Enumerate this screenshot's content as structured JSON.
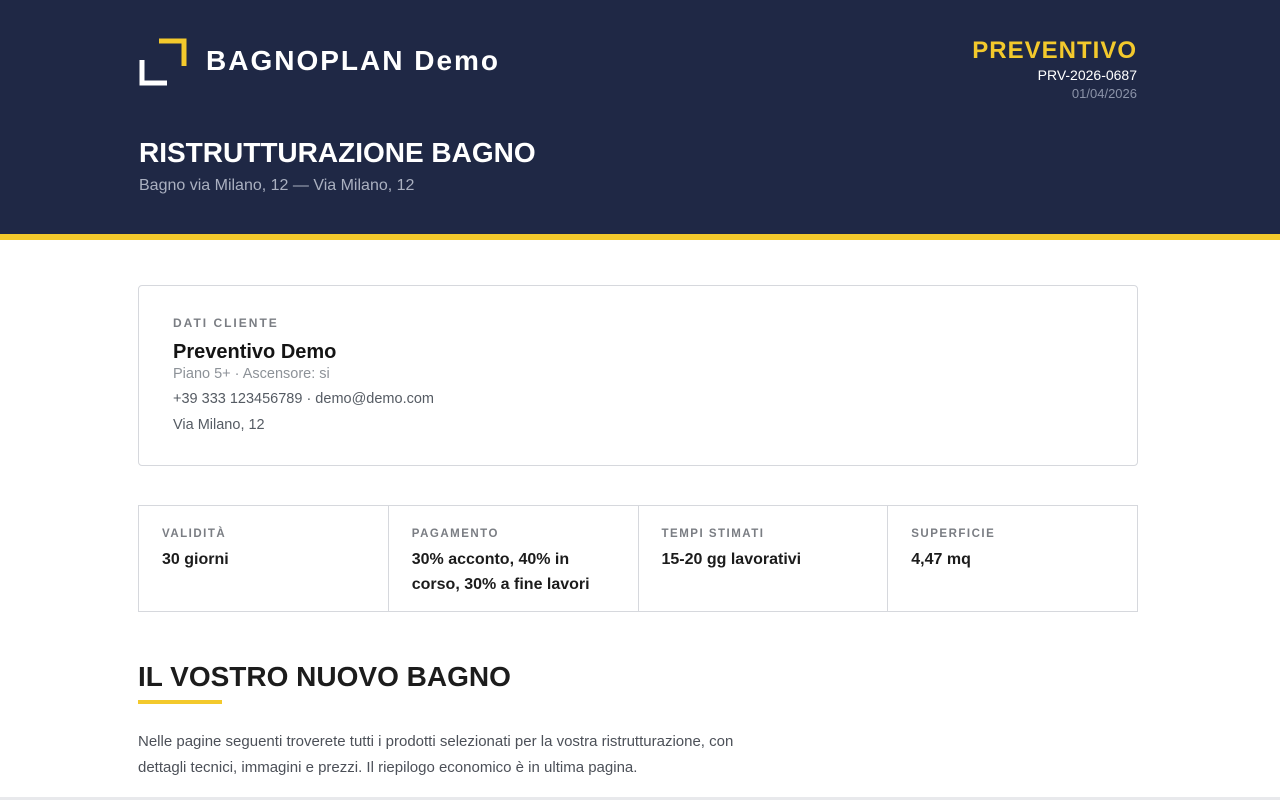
{
  "header": {
    "brand": "BAGNOPLAN Demo",
    "doc_type": "PREVENTIVO",
    "doc_number": "PRV-2026-0687",
    "doc_date": "01/04/2026",
    "project_title": "RISTRUTTURAZIONE BAGNO",
    "project_subtitle": "Bagno via Milano, 12 — Via Milano, 12",
    "logo_icon": "bracket-frame-icon",
    "accent_color": "#f3c92c",
    "bg_color": "#1f2845"
  },
  "client": {
    "label": "DATI CLIENTE",
    "name": "Preventivo Demo",
    "details": "Piano 5+ · Ascensore: si",
    "contacts": "+39 333 123456789 · demo@demo.com",
    "address": "Via Milano, 12"
  },
  "info": [
    {
      "label": "VALIDITÀ",
      "value": "30 giorni"
    },
    {
      "label": "PAGAMENTO",
      "value": "30% acconto, 40% in corso, 30% a fine lavori"
    },
    {
      "label": "TEMPI STIMATI",
      "value": "15-20 gg lavorativi"
    },
    {
      "label": "SUPERFICIE",
      "value": "4,47 mq"
    }
  ],
  "section": {
    "title": "IL VOSTRO NUOVO BAGNO",
    "text": "Nelle pagine seguenti troverete tutti i prodotti selezionati per la vostra ristrutturazione, con dettagli tecnici, immagini e prezzi. Il riepilogo economico è in ultima pagina."
  }
}
